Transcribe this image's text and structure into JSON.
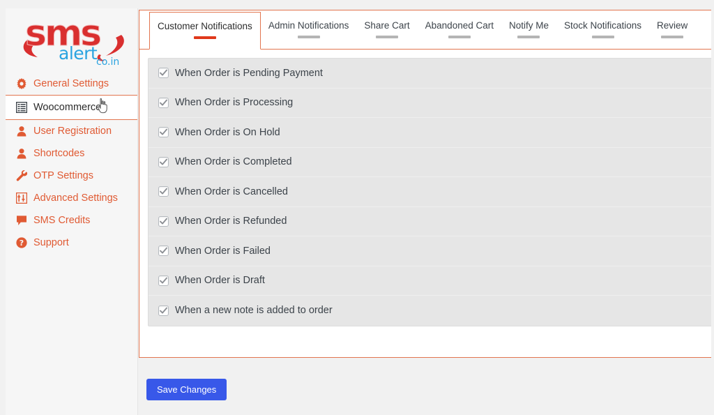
{
  "brand": {
    "logo_primary": "sms",
    "logo_secondary": "alert",
    "logo_tld": "co.in",
    "color_primary": "#d92f2f",
    "color_secondary": "#2aa3e0"
  },
  "sidebar": {
    "accent_color": "#e05a33",
    "items": [
      {
        "label": "General Settings",
        "icon": "gear-icon",
        "active": false
      },
      {
        "label": "Woocommerce",
        "icon": "grid-table-icon",
        "active": true
      },
      {
        "label": "User Registration",
        "icon": "user-icon",
        "active": false
      },
      {
        "label": "Shortcodes",
        "icon": "user-icon",
        "active": false
      },
      {
        "label": "OTP Settings",
        "icon": "wrench-icon",
        "active": false
      },
      {
        "label": "Advanced Settings",
        "icon": "sliders-icon",
        "active": false
      },
      {
        "label": "SMS Credits",
        "icon": "comment-icon",
        "active": false
      },
      {
        "label": "Support",
        "icon": "question-circle-icon",
        "active": false
      }
    ]
  },
  "main": {
    "panel_border_color": "#e2754f",
    "active_tab_bar_color": "#e0391b",
    "inactive_tab_bar_color": "#b5b5b5",
    "tabs": [
      {
        "label": "Customer Notifications",
        "active": true
      },
      {
        "label": "Admin Notifications",
        "active": false
      },
      {
        "label": "Share Cart",
        "active": false
      },
      {
        "label": "Abandoned Cart",
        "active": false
      },
      {
        "label": "Notify Me",
        "active": false
      },
      {
        "label": "Stock Notifications",
        "active": false
      },
      {
        "label": "Review",
        "active": false
      }
    ],
    "checkboxes": [
      {
        "label": "When Order is Pending Payment",
        "checked": true
      },
      {
        "label": "When Order is Processing",
        "checked": true
      },
      {
        "label": "When Order is On Hold",
        "checked": true
      },
      {
        "label": "When Order is Completed",
        "checked": true
      },
      {
        "label": "When Order is Cancelled",
        "checked": true
      },
      {
        "label": "When Order is Refunded",
        "checked": true
      },
      {
        "label": "When Order is Failed",
        "checked": true
      },
      {
        "label": "When Order is Draft",
        "checked": true
      },
      {
        "label": "When a new note is added to order",
        "checked": true
      }
    ]
  },
  "footer": {
    "save_label": "Save Changes",
    "save_color": "#3858e9"
  }
}
